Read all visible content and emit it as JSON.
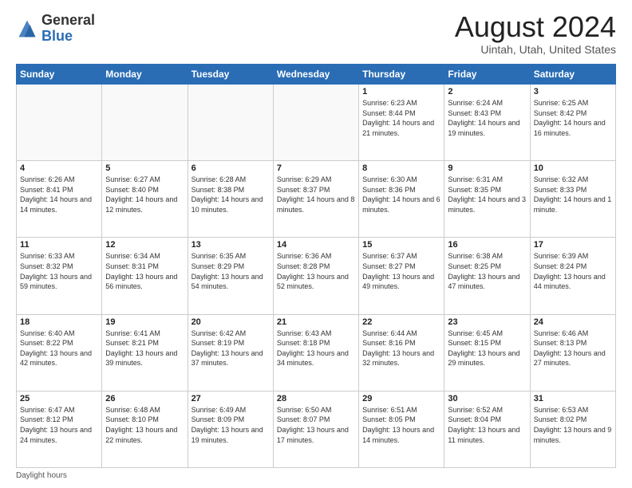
{
  "header": {
    "logo_general": "General",
    "logo_blue": "Blue",
    "month_title": "August 2024",
    "location": "Uintah, Utah, United States"
  },
  "days_of_week": [
    "Sunday",
    "Monday",
    "Tuesday",
    "Wednesday",
    "Thursday",
    "Friday",
    "Saturday"
  ],
  "weeks": [
    [
      {
        "day": "",
        "info": ""
      },
      {
        "day": "",
        "info": ""
      },
      {
        "day": "",
        "info": ""
      },
      {
        "day": "",
        "info": ""
      },
      {
        "day": "1",
        "info": "Sunrise: 6:23 AM\nSunset: 8:44 PM\nDaylight: 14 hours and 21 minutes."
      },
      {
        "day": "2",
        "info": "Sunrise: 6:24 AM\nSunset: 8:43 PM\nDaylight: 14 hours and 19 minutes."
      },
      {
        "day": "3",
        "info": "Sunrise: 6:25 AM\nSunset: 8:42 PM\nDaylight: 14 hours and 16 minutes."
      }
    ],
    [
      {
        "day": "4",
        "info": "Sunrise: 6:26 AM\nSunset: 8:41 PM\nDaylight: 14 hours and 14 minutes."
      },
      {
        "day": "5",
        "info": "Sunrise: 6:27 AM\nSunset: 8:40 PM\nDaylight: 14 hours and 12 minutes."
      },
      {
        "day": "6",
        "info": "Sunrise: 6:28 AM\nSunset: 8:38 PM\nDaylight: 14 hours and 10 minutes."
      },
      {
        "day": "7",
        "info": "Sunrise: 6:29 AM\nSunset: 8:37 PM\nDaylight: 14 hours and 8 minutes."
      },
      {
        "day": "8",
        "info": "Sunrise: 6:30 AM\nSunset: 8:36 PM\nDaylight: 14 hours and 6 minutes."
      },
      {
        "day": "9",
        "info": "Sunrise: 6:31 AM\nSunset: 8:35 PM\nDaylight: 14 hours and 3 minutes."
      },
      {
        "day": "10",
        "info": "Sunrise: 6:32 AM\nSunset: 8:33 PM\nDaylight: 14 hours and 1 minute."
      }
    ],
    [
      {
        "day": "11",
        "info": "Sunrise: 6:33 AM\nSunset: 8:32 PM\nDaylight: 13 hours and 59 minutes."
      },
      {
        "day": "12",
        "info": "Sunrise: 6:34 AM\nSunset: 8:31 PM\nDaylight: 13 hours and 56 minutes."
      },
      {
        "day": "13",
        "info": "Sunrise: 6:35 AM\nSunset: 8:29 PM\nDaylight: 13 hours and 54 minutes."
      },
      {
        "day": "14",
        "info": "Sunrise: 6:36 AM\nSunset: 8:28 PM\nDaylight: 13 hours and 52 minutes."
      },
      {
        "day": "15",
        "info": "Sunrise: 6:37 AM\nSunset: 8:27 PM\nDaylight: 13 hours and 49 minutes."
      },
      {
        "day": "16",
        "info": "Sunrise: 6:38 AM\nSunset: 8:25 PM\nDaylight: 13 hours and 47 minutes."
      },
      {
        "day": "17",
        "info": "Sunrise: 6:39 AM\nSunset: 8:24 PM\nDaylight: 13 hours and 44 minutes."
      }
    ],
    [
      {
        "day": "18",
        "info": "Sunrise: 6:40 AM\nSunset: 8:22 PM\nDaylight: 13 hours and 42 minutes."
      },
      {
        "day": "19",
        "info": "Sunrise: 6:41 AM\nSunset: 8:21 PM\nDaylight: 13 hours and 39 minutes."
      },
      {
        "day": "20",
        "info": "Sunrise: 6:42 AM\nSunset: 8:19 PM\nDaylight: 13 hours and 37 minutes."
      },
      {
        "day": "21",
        "info": "Sunrise: 6:43 AM\nSunset: 8:18 PM\nDaylight: 13 hours and 34 minutes."
      },
      {
        "day": "22",
        "info": "Sunrise: 6:44 AM\nSunset: 8:16 PM\nDaylight: 13 hours and 32 minutes."
      },
      {
        "day": "23",
        "info": "Sunrise: 6:45 AM\nSunset: 8:15 PM\nDaylight: 13 hours and 29 minutes."
      },
      {
        "day": "24",
        "info": "Sunrise: 6:46 AM\nSunset: 8:13 PM\nDaylight: 13 hours and 27 minutes."
      }
    ],
    [
      {
        "day": "25",
        "info": "Sunrise: 6:47 AM\nSunset: 8:12 PM\nDaylight: 13 hours and 24 minutes."
      },
      {
        "day": "26",
        "info": "Sunrise: 6:48 AM\nSunset: 8:10 PM\nDaylight: 13 hours and 22 minutes."
      },
      {
        "day": "27",
        "info": "Sunrise: 6:49 AM\nSunset: 8:09 PM\nDaylight: 13 hours and 19 minutes."
      },
      {
        "day": "28",
        "info": "Sunrise: 6:50 AM\nSunset: 8:07 PM\nDaylight: 13 hours and 17 minutes."
      },
      {
        "day": "29",
        "info": "Sunrise: 6:51 AM\nSunset: 8:05 PM\nDaylight: 13 hours and 14 minutes."
      },
      {
        "day": "30",
        "info": "Sunrise: 6:52 AM\nSunset: 8:04 PM\nDaylight: 13 hours and 11 minutes."
      },
      {
        "day": "31",
        "info": "Sunrise: 6:53 AM\nSunset: 8:02 PM\nDaylight: 13 hours and 9 minutes."
      }
    ]
  ],
  "footer": {
    "daylight_label": "Daylight hours"
  }
}
